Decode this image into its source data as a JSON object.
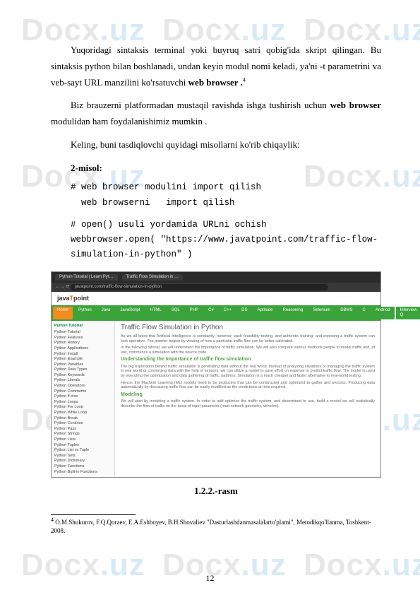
{
  "watermark": {
    "brand": "Docx",
    "suffix": ".uz"
  },
  "paragraphs": {
    "p1_a": "Yuqoridagi sintaksis terminal yoki buyruq satri qobig'ida skript qilingan. Bu sintaksis python bilan boshlanadi, undan keyin modul nomi keladi, ya'ni -t parametrini va veb-sayt URL manzilini ko'rsatuvchi ",
    "p1_b": "web browser .",
    "p1_sup": "4",
    "p2_a": "Biz brauzerni platformadan mustaqil ravishda ishga tushirish uchun ",
    "p2_b": "web browser",
    "p2_c": " modulidan ham foydalanishimiz mumkin .",
    "p3": "Keling, buni tasdiqlovchi quyidagi misollarni ko'rib chiqaylik:",
    "example_label": "2-misol:",
    "code1": "# web browser modulini import qilish\n  web browserni   import qilish",
    "code2": "# open() usuli yordamida URLni ochish\nwebbrowser.open( \"https://www.javatpoint.com/traffic-flow-simulation-in-python\" )"
  },
  "screenshot": {
    "tabs": [
      "Python Tutorial | Learn Pyt…",
      "Traffic Flow Simulation in …"
    ],
    "url": "javatpoint.com/traffic-flow-simulation-in-python",
    "brand_a": "java",
    "brand_b": "T",
    "brand_c": "point",
    "nav": [
      "Home",
      "Python",
      "Java",
      "JavaScript",
      "HTML",
      "SQL",
      "PHP",
      "C#",
      "C++",
      "DS",
      "Aptitude",
      "Reasoning",
      "Selenium",
      "DBMS",
      "C",
      "Andriod",
      "Interview Q"
    ],
    "sidebar_header": "Python Tutorial",
    "sidebar_items": [
      "Python Tutorial",
      "Python Features",
      "Python History",
      "Python Applications",
      "Python Install",
      "Python Example",
      "Python Variables",
      "Python Data Types",
      "Python Keywords",
      "Python Literals",
      "Python Operators",
      "Python Comments",
      "Python If else",
      "Python Loops",
      "Python For Loop",
      "Python While Loop",
      "Python Break",
      "Python Continue",
      "Python Pass",
      "Python Strings",
      "Python Lists",
      "Python Tuples",
      "Python List vs Tuple",
      "Python Sets",
      "Python Dictionary",
      "Python Functions",
      "Python Built-in Functions"
    ],
    "article": {
      "title": "Traffic Flow Simulation in Python",
      "p1": "As we all know that Artificial Intelligence is constantly, however, each feasibility testing, and authentic training, and exposing a traffic system can look operative. The planner begins by viewing of how a particular traffic flow can be better calibrated.",
      "p2": "In the following tutorial, we will understand the importance of traffic simulation. We will also compare various methods people to model traffic and, at last, commence a simulation with the source code.",
      "h2a": "Understanding the Importance of traffic flow simulation",
      "p3": "The big exploration behind traffic simulation is generating data without the real world. Instead of analyzing situations or managing the traffic system in real world or converging data with the help of sensors, we can utilize a model to save effort on expense to predict traffic flow. The model is used by executing the optimization and data gathering of traffic, patterns. Simulation is a much cheaper and faster alternative to real-world testing.",
      "p4": "Hence, the Machine Learning (ML) models need to be producers that can be constructed and optimized to gather and process. Producing data automatically by discussing traffic flow can be easily modified as the predictions at time required.",
      "h2b": "Modeling",
      "p5": "We will start by modeling a traffic system. In order to add optimize the traffic system, and determined to use, build a model we will realistically describe the flow of traffic on the basis of input parameter (road network geometry, vehicles)."
    }
  },
  "figure_caption": "1.2.2.-rasm",
  "footnote": {
    "marker": "4",
    "text": " O.M.Shukurov, F.Q.Qoraev, E.A.Eshboyev, B.H.Shovaliev \"Dasturlashdanmasalalarto'plami\", Metodikqo'llanma, Toshkent-2008."
  },
  "page_number": "12"
}
